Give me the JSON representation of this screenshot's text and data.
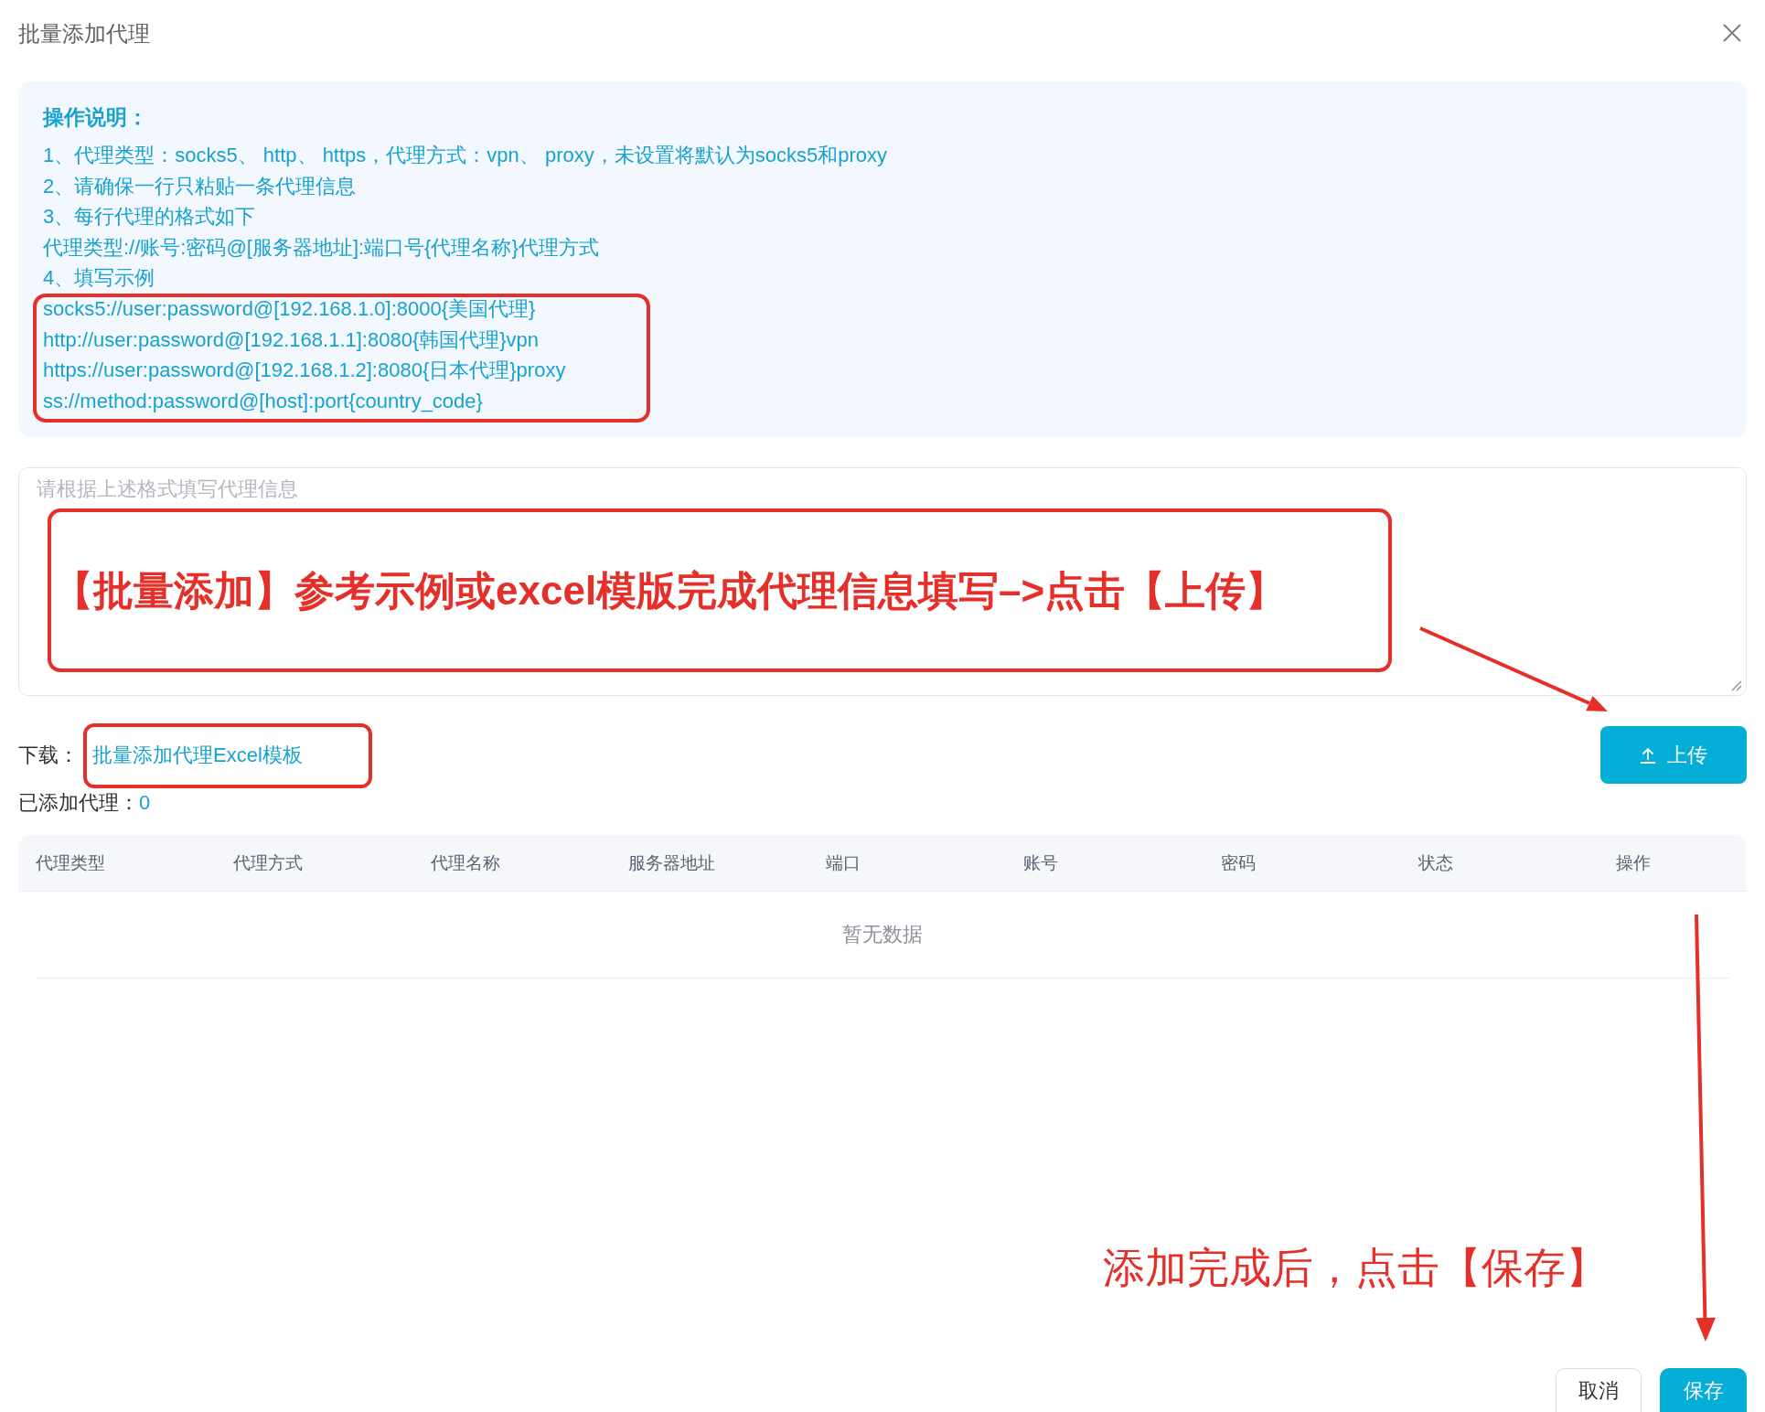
{
  "dialog": {
    "title": "批量添加代理"
  },
  "instructions": {
    "heading": "操作说明：",
    "lines": [
      "1、代理类型：socks5、 http、 https，代理方式：vpn、 proxy，未设置将默认为socks5和proxy",
      "2、请确保一行只粘贴一条代理信息",
      "3、每行代理的格式如下",
      "代理类型://账号:密码@[服务器地址]:端口号{代理名称}代理方式",
      "4、填写示例"
    ],
    "examples": [
      "socks5://user:password@[192.168.1.0]:8000{美国代理}",
      "http://user:password@[192.168.1.1]:8080{韩国代理}vpn",
      "https://user:password@[192.168.1.2]:8080{日本代理}proxy",
      "ss://method:password@[host]:port{country_code}"
    ]
  },
  "proxy_input": {
    "placeholder": "请根据上述格式填写代理信息"
  },
  "download": {
    "label": "下载：",
    "link": "批量添加代理Excel模板"
  },
  "upload_button": {
    "label": "上传"
  },
  "added_count": {
    "label": "已添加代理：",
    "value": "0"
  },
  "table": {
    "columns": [
      "代理类型",
      "代理方式",
      "代理名称",
      "服务器地址",
      "端口",
      "账号",
      "密码",
      "状态",
      "操作"
    ],
    "empty_text": "暂无数据"
  },
  "footer": {
    "buttons": [
      {
        "label": "取消",
        "kind": "secondary"
      },
      {
        "label": "保存",
        "kind": "primary"
      }
    ]
  },
  "annotations": {
    "upload_hint": "【批量添加】参考示例或excel模版完成代理信息填写–>点击【上传】",
    "save_hint": "添加完成后，点击【保存】"
  }
}
